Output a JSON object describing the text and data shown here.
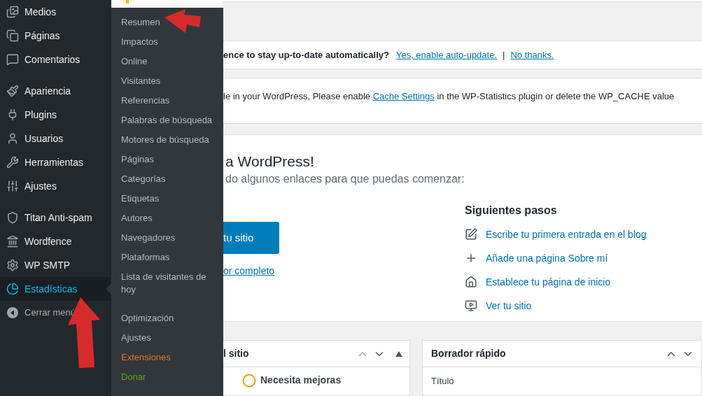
{
  "sidebar": {
    "groups": [
      {
        "items": [
          {
            "label": "Medios",
            "selected": false
          },
          {
            "label": "Páginas",
            "selected": false
          },
          {
            "label": "Comentarios",
            "selected": false
          }
        ]
      },
      {
        "items": [
          {
            "label": "Apariencia",
            "selected": false
          },
          {
            "label": "Plugins",
            "selected": false
          },
          {
            "label": "Usuarios",
            "selected": false
          },
          {
            "label": "Herramientas",
            "selected": false
          },
          {
            "label": "Ajustes",
            "selected": false
          }
        ]
      },
      {
        "items": [
          {
            "label": "Titan Anti-spam",
            "selected": false
          },
          {
            "label": "Wordfence",
            "selected": false
          },
          {
            "label": "WP SMTP",
            "selected": false
          },
          {
            "label": "Estadísticas",
            "selected": true
          }
        ]
      }
    ],
    "collapse": "Cerrar menú"
  },
  "submenu": {
    "groups": [
      {
        "items": [
          {
            "label": "Resumen",
            "kind": "default"
          },
          {
            "label": "Impactos",
            "kind": "default"
          },
          {
            "label": "Online",
            "kind": "default"
          },
          {
            "label": "Visitantes",
            "kind": "default"
          },
          {
            "label": "Referencias",
            "kind": "default"
          },
          {
            "label": "Palabras de búsqueda",
            "kind": "default"
          },
          {
            "label": "Motores de búsqueda",
            "kind": "default"
          },
          {
            "label": "Páginas",
            "kind": "default"
          },
          {
            "label": "Categorías",
            "kind": "default"
          },
          {
            "label": "Etiquetas",
            "kind": "default"
          },
          {
            "label": "Autores",
            "kind": "default"
          },
          {
            "label": "Navegadores",
            "kind": "default"
          },
          {
            "label": "Plataformas",
            "kind": "default"
          },
          {
            "label": "Lista de visitantes de hoy",
            "kind": "default"
          }
        ]
      },
      {
        "items": [
          {
            "label": "Optimización",
            "kind": "default"
          },
          {
            "label": "Ajustes",
            "kind": "default"
          },
          {
            "label": "Extensiones",
            "kind": "upgrade"
          },
          {
            "label": "Donar",
            "kind": "donate"
          }
        ]
      }
    ]
  },
  "autoupdate_notice": {
    "question": "ence to stay up-to-date automatically?",
    "links": [
      "Yes, enable auto-update.",
      "No thanks."
    ],
    "separator": "|"
  },
  "cache_notice": {
    "before": "le in your WordPress, Please enable ",
    "link": "Cache Settings",
    "after": " in the WP-Statistics plugin or delete the WP_CACHE value"
  },
  "welcome": {
    "title": "a WordPress!",
    "subtitle": "do algunos enlaces para que puedas comenzar:",
    "button": "tu sitio",
    "link": "or completo",
    "next_steps": {
      "title": "Siguientes pasos",
      "items": [
        "Escribe tu primera entrada en el blog",
        "Añade una página Sobre mí",
        "Establece tu página de inicio",
        "Ver tu sitio"
      ]
    }
  },
  "widgets": [
    {
      "kind": "health",
      "title": "l sitio",
      "move_up_disabled": true,
      "status": "Necesita mejoras"
    },
    {
      "kind": "draft",
      "title": "Borrador rápido",
      "move_up_disabled": false,
      "field_label": "Título"
    }
  ]
}
